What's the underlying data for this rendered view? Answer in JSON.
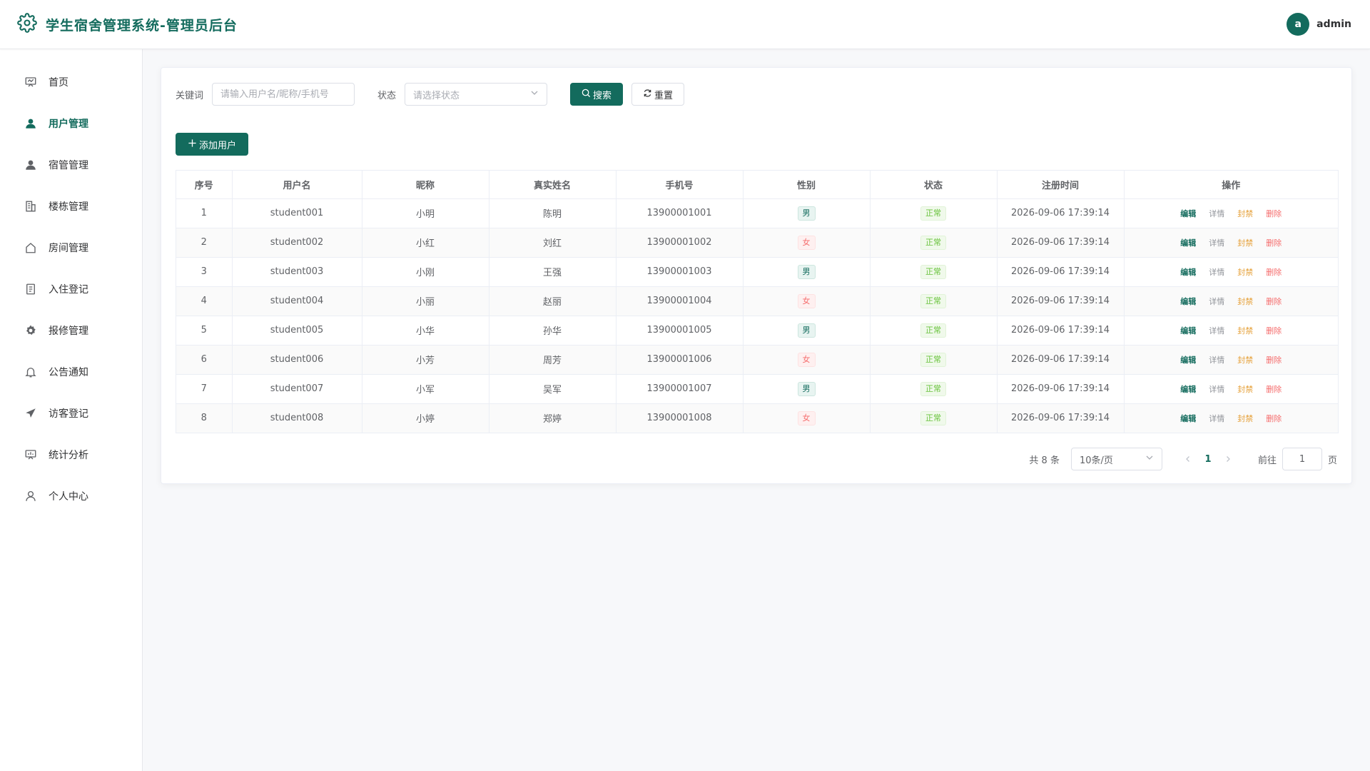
{
  "header": {
    "title": "学生宿舍管理系统-管理员后台",
    "avatar_letter": "a",
    "username": "admin",
    "accent": "#136b5d"
  },
  "sidebar": {
    "items": [
      {
        "label": "首页",
        "icon": "dashboard-icon",
        "active": false
      },
      {
        "label": "用户管理",
        "icon": "user-icon",
        "active": true
      },
      {
        "label": "宿管管理",
        "icon": "user-icon",
        "active": false
      },
      {
        "label": "楼栋管理",
        "icon": "building-icon",
        "active": false
      },
      {
        "label": "房间管理",
        "icon": "home-icon",
        "active": false
      },
      {
        "label": "入住登记",
        "icon": "document-icon",
        "active": false
      },
      {
        "label": "报修管理",
        "icon": "gear-icon",
        "active": false
      },
      {
        "label": "公告通知",
        "icon": "bell-icon",
        "active": false
      },
      {
        "label": "访客登记",
        "icon": "send-icon",
        "active": false
      },
      {
        "label": "统计分析",
        "icon": "chart-icon",
        "active": false
      },
      {
        "label": "个人中心",
        "icon": "person-icon",
        "active": false
      }
    ]
  },
  "filters": {
    "keyword_label": "关键词",
    "keyword_placeholder": "请输入用户名/昵称/手机号",
    "status_label": "状态",
    "status_placeholder": "请选择状态",
    "search_label": "搜索",
    "reset_label": "重置"
  },
  "toolbar": {
    "add_label": "添加用户"
  },
  "table": {
    "columns": [
      "序号",
      "用户名",
      "昵称",
      "真实姓名",
      "手机号",
      "性别",
      "状态",
      "注册时间",
      "操作"
    ],
    "ops": {
      "edit": "编辑",
      "detail": "详情",
      "ban": "封禁",
      "delete": "删除"
    },
    "rows": [
      {
        "index": "1",
        "username": "student001",
        "nickname": "小明",
        "realname": "陈明",
        "phone": "13900001001",
        "gender": "男",
        "status": "正常",
        "registered": "2026-09-06 17:39:14"
      },
      {
        "index": "2",
        "username": "student002",
        "nickname": "小红",
        "realname": "刘红",
        "phone": "13900001002",
        "gender": "女",
        "status": "正常",
        "registered": "2026-09-06 17:39:14"
      },
      {
        "index": "3",
        "username": "student003",
        "nickname": "小刚",
        "realname": "王强",
        "phone": "13900001003",
        "gender": "男",
        "status": "正常",
        "registered": "2026-09-06 17:39:14"
      },
      {
        "index": "4",
        "username": "student004",
        "nickname": "小丽",
        "realname": "赵丽",
        "phone": "13900001004",
        "gender": "女",
        "status": "正常",
        "registered": "2026-09-06 17:39:14"
      },
      {
        "index": "5",
        "username": "student005",
        "nickname": "小华",
        "realname": "孙华",
        "phone": "13900001005",
        "gender": "男",
        "status": "正常",
        "registered": "2026-09-06 17:39:14"
      },
      {
        "index": "6",
        "username": "student006",
        "nickname": "小芳",
        "realname": "周芳",
        "phone": "13900001006",
        "gender": "女",
        "status": "正常",
        "registered": "2026-09-06 17:39:14"
      },
      {
        "index": "7",
        "username": "student007",
        "nickname": "小军",
        "realname": "吴军",
        "phone": "13900001007",
        "gender": "男",
        "status": "正常",
        "registered": "2026-09-06 17:39:14"
      },
      {
        "index": "8",
        "username": "student008",
        "nickname": "小婷",
        "realname": "郑婷",
        "phone": "13900001008",
        "gender": "女",
        "status": "正常",
        "registered": "2026-09-06 17:39:14"
      }
    ]
  },
  "pagination": {
    "total_text": "共 8 条",
    "page_size": "10条/页",
    "current_page": "1",
    "goto_label": "前往",
    "goto_value": "1",
    "page_suffix": "页"
  }
}
